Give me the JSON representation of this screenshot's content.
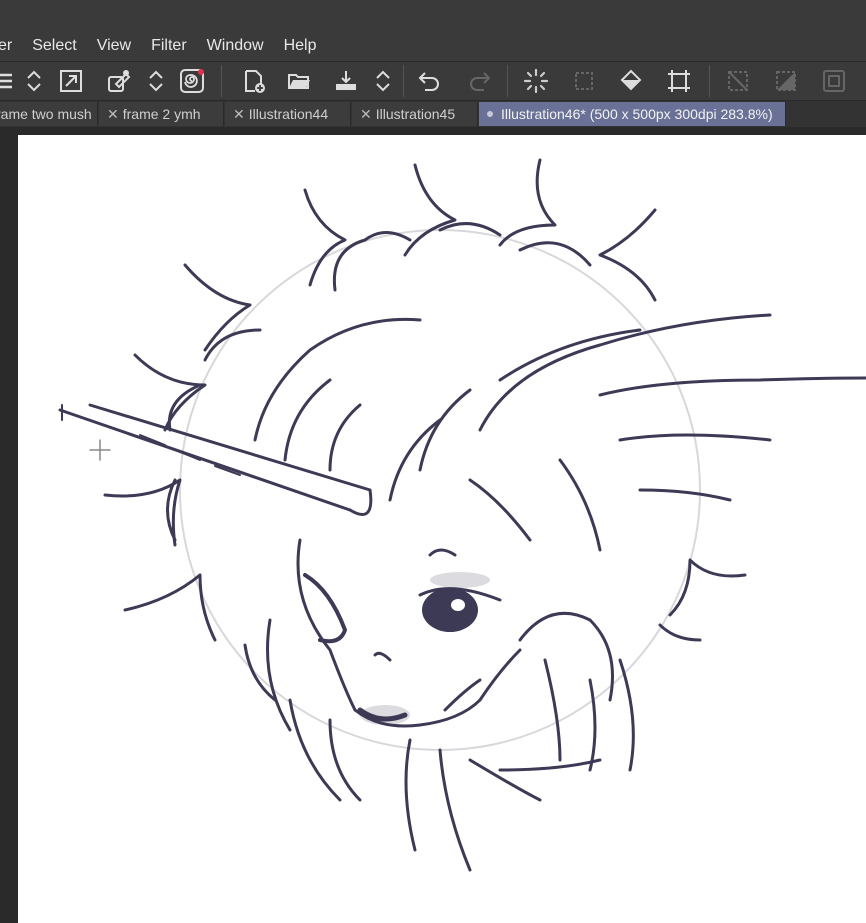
{
  "menu": {
    "items": [
      "er",
      "Select",
      "View",
      "Filter",
      "Window",
      "Help"
    ]
  },
  "toolbar": {
    "tools": [
      "menu-icon",
      "up-down-arrows-icon",
      "resize-icon",
      "eyedropper-icon",
      "up-down-arrows-icon",
      "spiral-icon",
      "new-file-icon",
      "open-folder-icon",
      "export-icon",
      "up-down-arrows-icon",
      "undo-icon",
      "redo-icon",
      "loading-icon",
      "select-layer-icon",
      "fill-icon",
      "transform-icon",
      "clear-selection-icon",
      "invert-selection-icon",
      "selection-border-icon"
    ]
  },
  "tabs": [
    {
      "label": "rame two mush",
      "closable": false,
      "active": false
    },
    {
      "label": "frame 2 ymh",
      "closable": true,
      "active": false
    },
    {
      "label": "Illustration44",
      "closable": true,
      "active": false
    },
    {
      "label": "Illustration45",
      "closable": true,
      "active": false
    },
    {
      "label": "Illustration46* (500 x 500px 300dpi 283.8%)",
      "closable": false,
      "active": true
    }
  ],
  "colors": {
    "chrome": "#3a3a3a",
    "active_tab": "#6a7196",
    "ink": "#3d3a55",
    "accent_red": "#e0304a"
  }
}
